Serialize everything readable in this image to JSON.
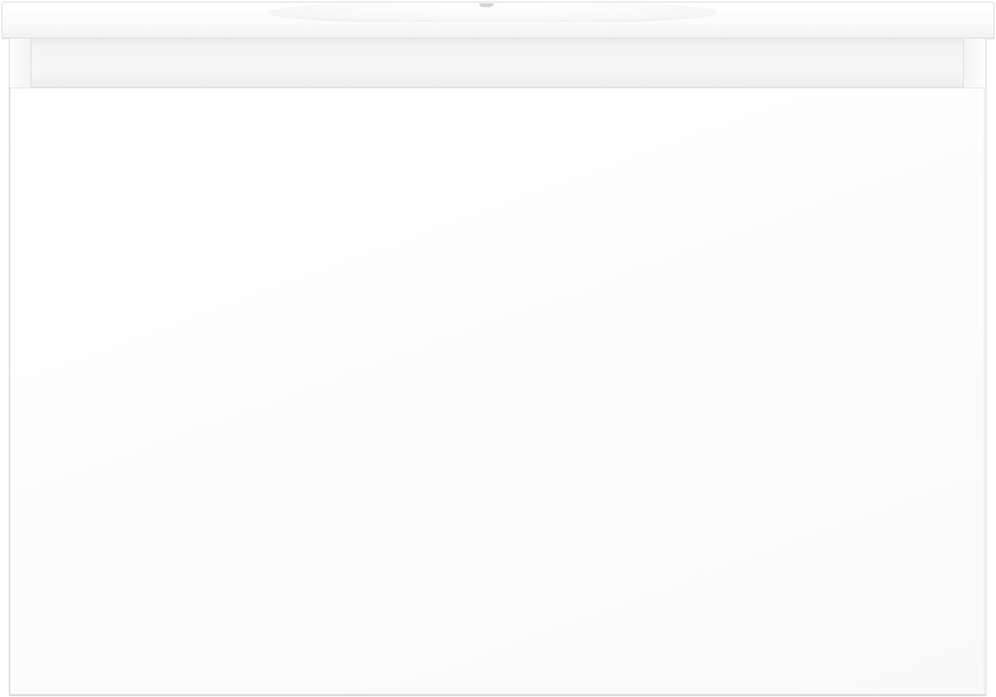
{
  "colors": {
    "background": "#ffffff",
    "cabinet": "#ffffff",
    "outline": "#d8d8d8",
    "handle_recess": "#f3f3f3"
  },
  "product": {
    "parts": [
      "basin-top",
      "handle-recess",
      "drawer-front"
    ]
  }
}
